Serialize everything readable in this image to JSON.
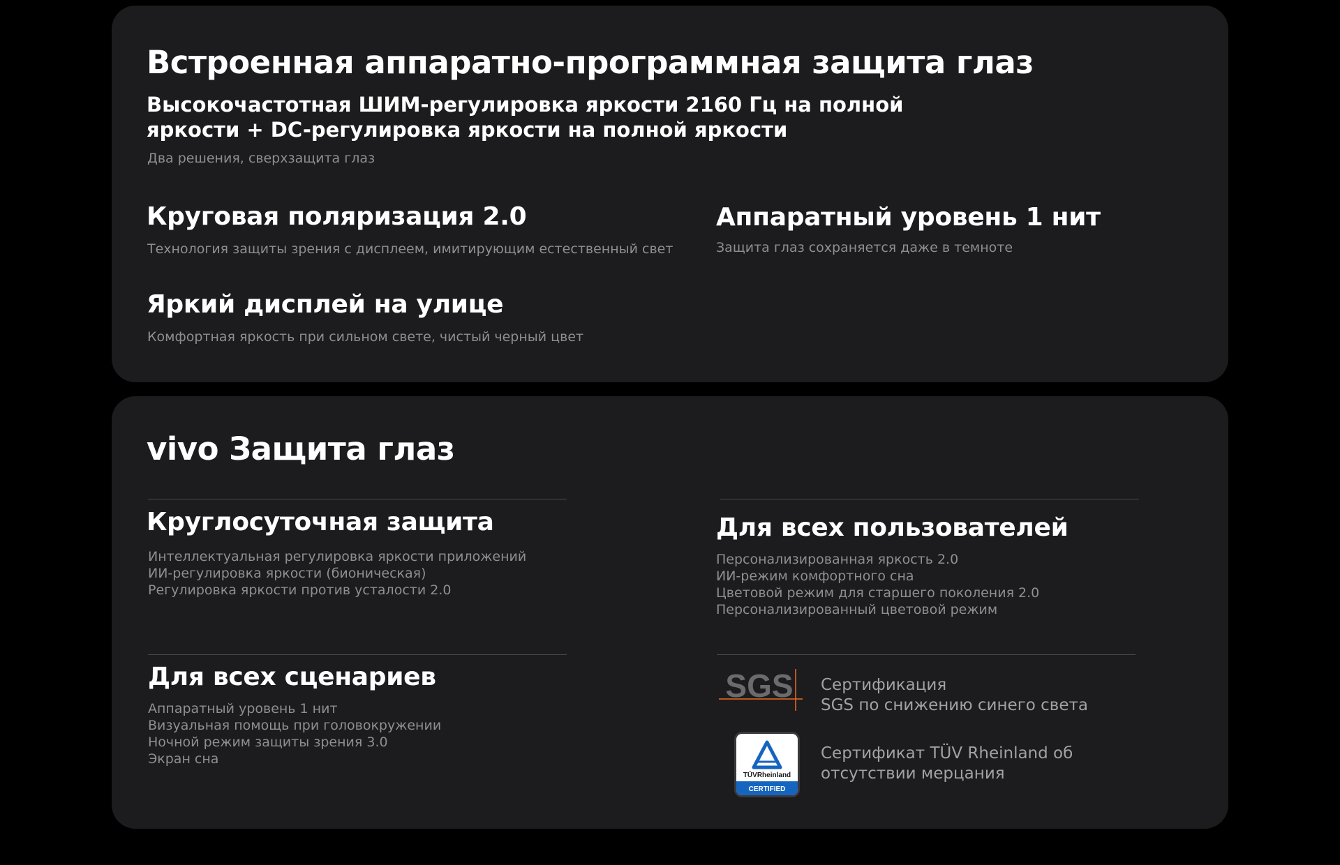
{
  "card1": {
    "title": "Встроенная аппаратно-программная защита глаз",
    "subtitle": "Высокочастотная ШИМ-регулировка яркости 2160 Гц на полной яркости + DC-регулировка яркости на полной яркости",
    "caption": "Два решения, сверхзащита глаз",
    "features": [
      {
        "title": "Круговая поляризация 2.0",
        "desc": "Технология защиты зрения с дисплеем, имитирующим естественный свет"
      },
      {
        "title": "Аппаратный уровень 1 нит",
        "desc": "Защита глаз сохраняется даже в темноте"
      },
      {
        "title": "Яркий дисплей на улице",
        "desc": "Комфортная яркость при сильном свете, чистый черный цвет"
      }
    ]
  },
  "card2": {
    "title": "vivo Защита глаз",
    "sections": [
      {
        "title": "Круглосуточная защита",
        "items": [
          "Интеллектуальная регулировка яркости приложений",
          "ИИ-регулировка яркости (бионическая)",
          "Регулировка яркости против усталости 2.0"
        ]
      },
      {
        "title": "Для всех пользователей",
        "items": [
          "Персонализированная яркость 2.0",
          "ИИ-режим комфортного сна",
          "Цветовой режим для старшего поколения 2.0",
          "Персонализированный цветовой режим"
        ]
      },
      {
        "title": "Для всех сценариев",
        "items": [
          "Аппаратный уровень 1 нит",
          "Визуальная помощь при головокружении",
          "Ночной режим защиты зрения 3.0",
          "Экран сна"
        ]
      }
    ],
    "certifications": [
      {
        "logo_text": "SGS",
        "line1": "Сертификация",
        "line2": "SGS по снижению синего света",
        "icon": "sgs-logo-icon"
      },
      {
        "logo_text": "TÜVRheinland",
        "logo_badge": "CERTIFIED",
        "line1": "Сертификат TÜV Rheinland об",
        "line2": "отсутствии мерцания",
        "icon": "tuv-rheinland-logo-icon"
      }
    ]
  },
  "colors": {
    "background": "#000000",
    "card": "#1c1c1e",
    "text_primary": "#ffffff",
    "text_secondary": "#8e8e93",
    "divider": "#4a4a4f",
    "sgs_orange": "#f26a21",
    "tuv_blue": "#1565c0"
  }
}
